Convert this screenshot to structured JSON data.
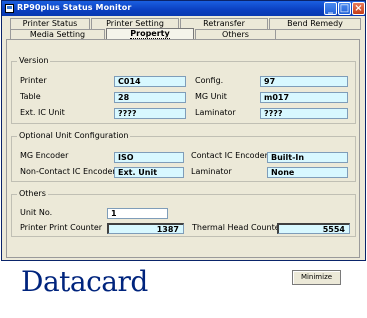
{
  "window": {
    "title": "RP90plus Status Monitor"
  },
  "tabs_row1": [
    "Printer Status",
    "Printer Setting",
    "Retransfer",
    "Bend Remedy"
  ],
  "tabs_row2": [
    "Media Setting",
    "Property",
    "Others"
  ],
  "active_tab": "Property",
  "version": {
    "label": "Version",
    "printer_label": "Printer",
    "printer_value": "C014",
    "config_label": "Config.",
    "config_value": "97",
    "table_label": "Table",
    "table_value": "28",
    "mg_unit_label": "MG Unit",
    "mg_unit_value": "m017",
    "ext_ic_label": "Ext. IC Unit",
    "ext_ic_value": "????",
    "laminator_label": "Laminator",
    "laminator_value": "????"
  },
  "optional": {
    "label": "Optional Unit Configuration",
    "mg_encoder_label": "MG Encoder",
    "mg_encoder_value": "ISO",
    "contact_ic_label": "Contact IC Encoder",
    "contact_ic_value": "Built-In",
    "noncontact_ic_label": "Non-Contact IC Encoder",
    "noncontact_ic_value": "Ext. Unit",
    "laminator_label": "Laminator",
    "laminator_value": "None"
  },
  "others": {
    "label": "Others",
    "unit_no_label": "Unit No.",
    "unit_no_value": "1",
    "print_counter_label": "Printer Print Counter",
    "print_counter_value": "1387",
    "thermal_counter_label": "Thermal Head Counter",
    "thermal_counter_value": "5554"
  },
  "brand": "Datacard",
  "minimize_label": "Minimize",
  "colors": {
    "title_bar": "#0a3fc0",
    "field_bg": "#d8f8ff",
    "brand": "#00247d",
    "window_bg": "#ece9d8"
  }
}
